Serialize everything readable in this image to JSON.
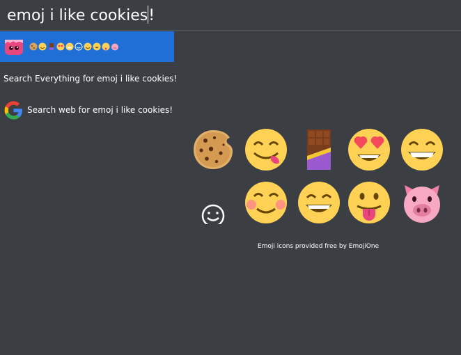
{
  "search": {
    "query": "emoj i like cookies",
    "query_suffix": "!"
  },
  "results": {
    "emoji_row_icons": [
      "cookie",
      "face-savoring-food",
      "chocolate-bar",
      "heart-eyes",
      "grinning",
      "smiling-face",
      "blushing",
      "grinning-smile",
      "tongue-out",
      "pig-face"
    ],
    "search_everything": "Search Everything for emoj i like cookies!",
    "search_web": "Search web for emoj i like cookies!"
  },
  "emoji_grid": {
    "rows": [
      [
        "cookie",
        "face-savoring-food",
        "chocolate-bar",
        "smiling-face-with-heart-eyes",
        "grinning-face-with-smiling-eyes"
      ],
      [
        "white-smiling-face",
        "smiling-face-with-blush",
        "grinning-face-closed-eyes",
        "face-with-tongue",
        "pig-face"
      ]
    ],
    "credit": "Emoji icons provided free by EmojiOne"
  },
  "colors": {
    "background": "#3b3e42",
    "highlight": "#1f6fd6",
    "emoji_yellow": "#ffd255"
  }
}
